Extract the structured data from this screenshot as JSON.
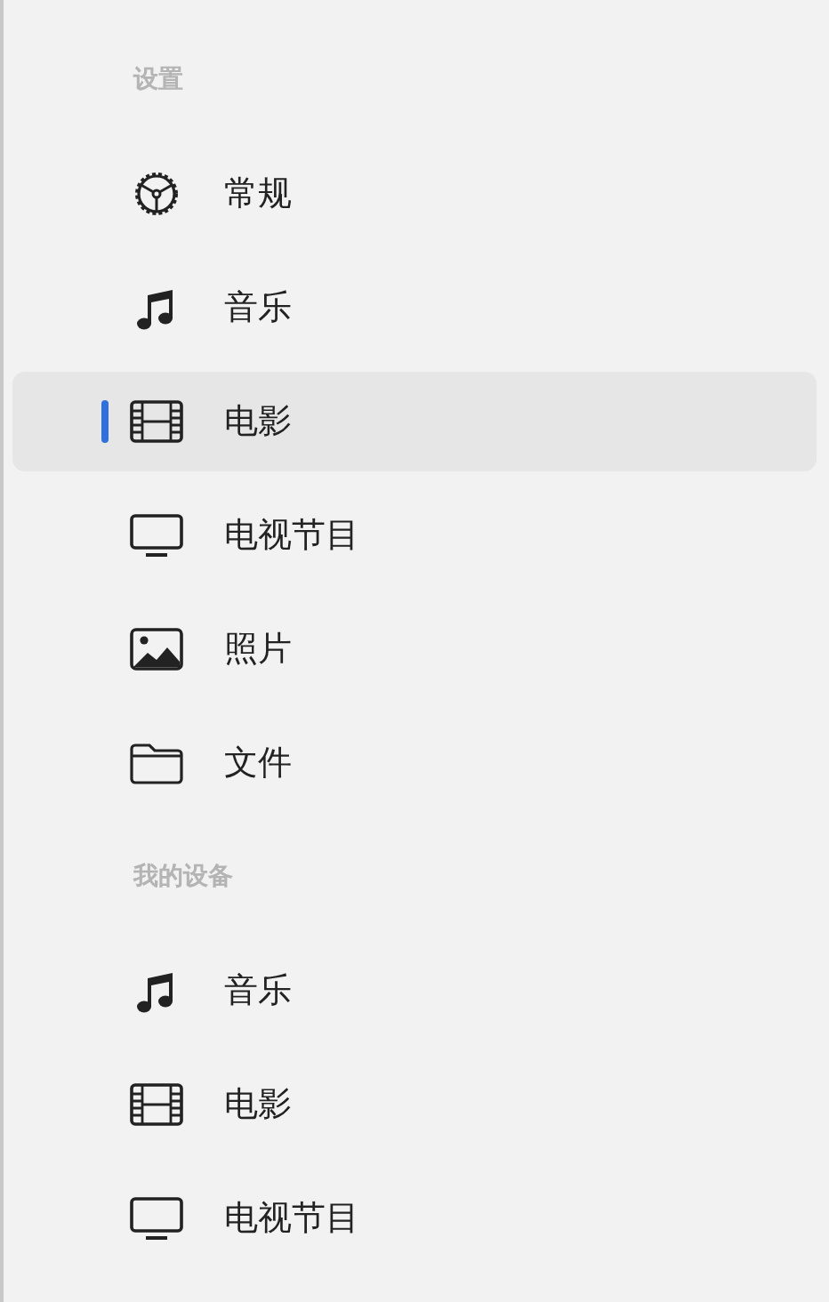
{
  "sections": [
    {
      "title": "设置",
      "items": [
        {
          "kind": "gear",
          "label": "常规",
          "selected": false
        },
        {
          "kind": "music",
          "label": "音乐",
          "selected": false
        },
        {
          "kind": "film",
          "label": "电影",
          "selected": true
        },
        {
          "kind": "tv",
          "label": "电视节目",
          "selected": false
        },
        {
          "kind": "photo",
          "label": "照片",
          "selected": false
        },
        {
          "kind": "folder",
          "label": "文件",
          "selected": false
        }
      ]
    },
    {
      "title": "我的设备",
      "items": [
        {
          "kind": "music",
          "label": "音乐",
          "selected": false
        },
        {
          "kind": "film",
          "label": "电影",
          "selected": false
        },
        {
          "kind": "tv",
          "label": "电视节目",
          "selected": false
        }
      ]
    }
  ]
}
